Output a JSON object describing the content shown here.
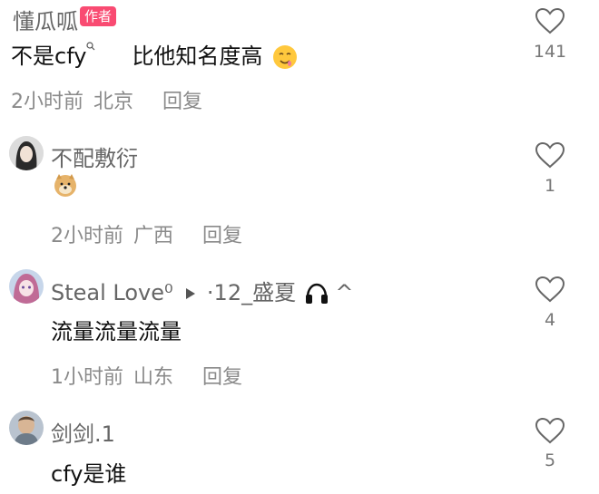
{
  "comments": [
    {
      "username": "懂瓜呱",
      "badge": "作者",
      "text_part1": "不是cfy",
      "text_part2": "比他知名度高",
      "time": "2小时前",
      "location": "北京",
      "reply_label": "回复",
      "likes": "141"
    },
    {
      "username": "不配敷衍",
      "time": "2小时前",
      "location": "广西",
      "reply_label": "回复",
      "likes": "1"
    },
    {
      "username": "Steal Love⁰",
      "username_extra": "·12_盛夏",
      "username_suffix": "^",
      "text": "流量流量流量",
      "time": "1小时前",
      "location": "山东",
      "reply_label": "回复",
      "likes": "4"
    },
    {
      "username": "剑剑.1",
      "text": "cfy是谁",
      "likes": "5"
    }
  ],
  "colors": {
    "badge": "#f94b72",
    "name": "#666666",
    "meta": "#8a8a8a",
    "text": "#111111"
  },
  "icons": [
    "heart-icon",
    "search-icon",
    "play-icon",
    "headphones-icon",
    "doge-emoji",
    "drooling-emoji"
  ]
}
